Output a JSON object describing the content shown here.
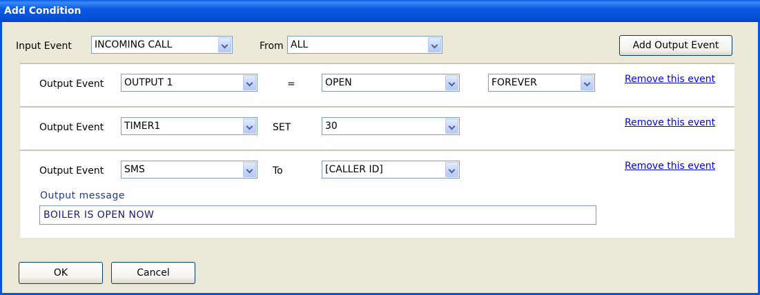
{
  "window": {
    "title": "Add Condition"
  },
  "input_row": {
    "input_event_label": "Input Event",
    "input_event_value": "INCOMING CALL",
    "from_label": "From",
    "from_value": "ALL",
    "add_output_button": "Add Output Event"
  },
  "output_events": [
    {
      "label": "Output Event",
      "event_value": "OUTPUT 1",
      "operator": "=",
      "second_value": "OPEN",
      "duration_value": "FOREVER",
      "remove_link": "Remove this event"
    },
    {
      "label": "Output Event",
      "event_value": "TIMER1",
      "operator": "SET",
      "second_value": "30",
      "remove_link": "Remove this event"
    },
    {
      "label": "Output Event",
      "event_value": "SMS",
      "operator": "To",
      "second_value": "[CALLER ID]",
      "message_label": "Output message",
      "message_value": "BOILER IS OPEN NOW",
      "remove_link": "Remove this event"
    }
  ],
  "footer": {
    "ok_label": "OK",
    "cancel_label": "Cancel"
  },
  "colors": {
    "titlebar": "#0054e3",
    "dialog_bg": "#ece9d8",
    "link": "#0000ff",
    "message_label": "#1b3c8c"
  }
}
